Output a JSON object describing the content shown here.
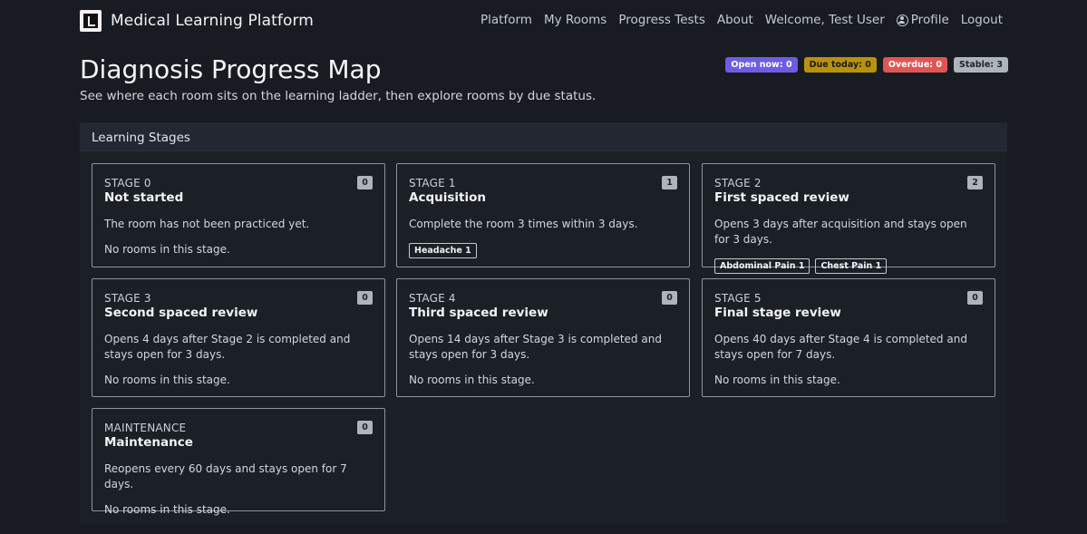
{
  "app": {
    "brand_name": "Medical Learning Platform",
    "logo_icon": "bookmark-logo-icon"
  },
  "nav": {
    "platform": "Platform",
    "my_rooms": "My Rooms",
    "progress_tests": "Progress Tests",
    "about": "About",
    "welcome": "Welcome, Test User",
    "profile": "Profile",
    "profile_icon": "user-circle-icon",
    "logout": "Logout"
  },
  "header": {
    "title": "Diagnosis Progress Map",
    "subtitle": "See where each room sits on the learning ladder, then explore rooms by due status."
  },
  "status_badges": {
    "open_now": "Open now: 0",
    "due_today": "Due today: 0",
    "overdue": "Overdue: 0",
    "stable": "Stable: 3",
    "colors": {
      "open_now": "#6d5ce6",
      "due_today": "#b8920c",
      "overdue": "#e25555",
      "stable": "#aeb4bc"
    }
  },
  "section": {
    "title": "Learning Stages"
  },
  "stages": [
    {
      "stage": "STAGE 0",
      "title": "Not started",
      "count": "0",
      "description": "The room has not been practiced yet.",
      "empty_text": "No rooms in this stage.",
      "rooms": []
    },
    {
      "stage": "STAGE 1",
      "title": "Acquisition",
      "count": "1",
      "description": "Complete the room 3 times within 3 days.",
      "empty_text": "",
      "rooms": [
        "Headache 1"
      ]
    },
    {
      "stage": "STAGE 2",
      "title": "First spaced review",
      "count": "2",
      "description": "Opens 3 days after acquisition and stays open for 3 days.",
      "empty_text": "",
      "rooms": [
        "Abdominal Pain 1",
        "Chest Pain 1"
      ]
    },
    {
      "stage": "STAGE 3",
      "title": "Second spaced review",
      "count": "0",
      "description": "Opens 4 days after Stage 2 is completed and stays open for 3 days.",
      "empty_text": "No rooms in this stage.",
      "rooms": []
    },
    {
      "stage": "STAGE 4",
      "title": "Third spaced review",
      "count": "0",
      "description": "Opens 14 days after Stage 3 is completed and stays open for 3 days.",
      "empty_text": "No rooms in this stage.",
      "rooms": []
    },
    {
      "stage": "STAGE 5",
      "title": "Final stage review",
      "count": "0",
      "description": "Opens 40 days after Stage 4 is completed and stays open for 7 days.",
      "empty_text": "No rooms in this stage.",
      "rooms": []
    },
    {
      "stage": "MAINTENANCE",
      "title": "Maintenance",
      "count": "0",
      "description": "Reopens every 60 days and stays open for 7 days.",
      "empty_text": "No rooms in this stage.",
      "rooms": []
    }
  ]
}
